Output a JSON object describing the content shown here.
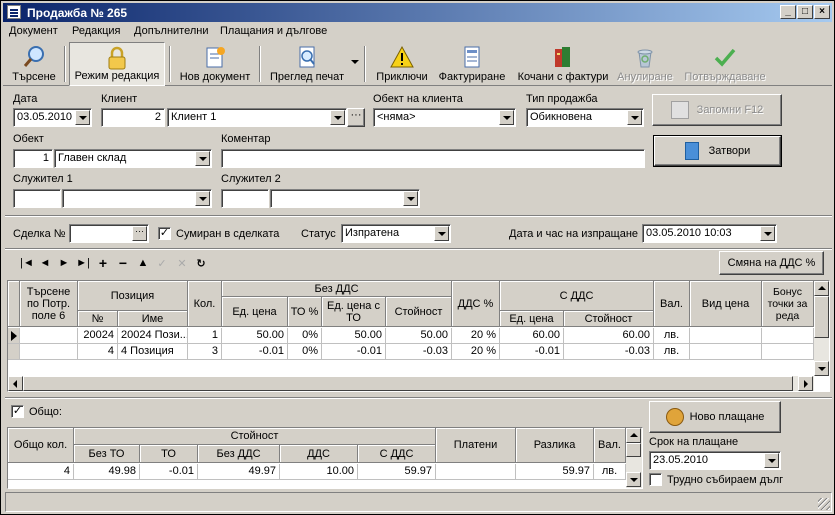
{
  "window": {
    "title": "Продажба № 265",
    "minimize": "_",
    "maximize": "□",
    "close": "×"
  },
  "menu": [
    "Документ",
    "Редакция",
    "Допълнителни",
    "Плащания и дългове"
  ],
  "toolbar": {
    "search": "Търсене",
    "edit_mode": "Режим редакция",
    "new_doc": "Нов документ",
    "print_preview": "Преглед печат",
    "finish": "Приключи",
    "invoicing": "Фактуриране",
    "attached_invoices": "Кочани с фактури",
    "cancel": "Анулиране",
    "confirm": "Потвърждаване"
  },
  "form": {
    "date_label": "Дата",
    "date_value": "03.05.2010",
    "client_label": "Клиент",
    "client_code": "2",
    "client_name": "Клиент 1",
    "client_object_label": "Обект на клиента",
    "client_object_value": "<няма>",
    "sale_type_label": "Тип продажба",
    "sale_type_value": "Обикновена",
    "object_label": "Обект",
    "object_code": "1",
    "object_name": "Главен склад",
    "comment_label": "Коментар",
    "comment_value": "",
    "employee1_label": "Служител 1",
    "employee2_label": "Служител 2",
    "save_button": "Запомни  F12",
    "close_button": "Затвори"
  },
  "deal": {
    "deal_label": "Сделка №",
    "deal_value": "",
    "summed_label": "Сумиран в сделката",
    "summed_checked": "✓",
    "status_label": "Статус",
    "status_value": "Изпратена",
    "send_dt_label": "Дата и час на изпращане",
    "send_dt_value": "03.05.2010 10:03"
  },
  "nav": {
    "first": "|◄",
    "prev": "◄",
    "next": "►",
    "last": "►|",
    "add": "+",
    "delete": "−",
    "up": "▲",
    "post": "✓",
    "cancel": "✕",
    "refresh": "↻"
  },
  "change_vat_button": "Смяна на ДДС %",
  "items_grid": {
    "headers": {
      "search_col": "Търсене по Потр. поле 6",
      "position": "Позиция",
      "no": "№",
      "name": "Име",
      "qty": "Кол.",
      "no_vat": "Без ДДС",
      "unit_price": "Ед. цена",
      "to_pct": "ТО %",
      "unit_price_to": "Ед. цена с ТО",
      "value": "Стойност",
      "vat_pct": "ДДС %",
      "with_vat": "С ДДС",
      "unit_price2": "Ед. цена",
      "value2": "Стойност",
      "currency": "Вал.",
      "price_type": "Вид цена",
      "bonus": "Бонус точки за реда"
    },
    "rows": [
      {
        "search": "",
        "no": "20024",
        "name": "20024 Пози...",
        "qty": "1",
        "unit_price": "50.00",
        "to": "0%",
        "price_to": "50.00",
        "value": "50.00",
        "vat": "20 %",
        "price_vat": "60.00",
        "value_vat": "60.00",
        "cur": "лв.",
        "ptype": "",
        "bonus": ""
      },
      {
        "search": "",
        "no": "4",
        "name": "4 Позиция",
        "qty": "3",
        "unit_price": "-0.01",
        "to": "0%",
        "price_to": "-0.01",
        "value": "-0.03",
        "vat": "20 %",
        "price_vat": "-0.01",
        "value_vat": "-0.03",
        "cur": "лв.",
        "ptype": "",
        "bonus": ""
      }
    ]
  },
  "totals": {
    "total_label": "Общо:",
    "total_checked": "✓",
    "headers": {
      "qty": "Общо кол.",
      "value": "Стойност",
      "no_to": "Без ТО",
      "to": "ТО",
      "no_vat": "Без ДДС",
      "vat": "ДДС",
      "with_vat": "С ДДС",
      "paid": "Платени",
      "diff": "Разлика",
      "cur": "Вал."
    },
    "row": {
      "qty": "4",
      "no_to": "49.98",
      "to": "-0.01",
      "no_vat": "49.97",
      "vat": "10.00",
      "with_vat": "59.97",
      "paid": "",
      "diff": "59.97",
      "cur": "лв."
    }
  },
  "payment": {
    "new_payment": "Ново плащане",
    "due_label": "Срок на плащане",
    "due_value": "23.05.2010",
    "hard_debt_label": "Трудно събираем дълг"
  }
}
